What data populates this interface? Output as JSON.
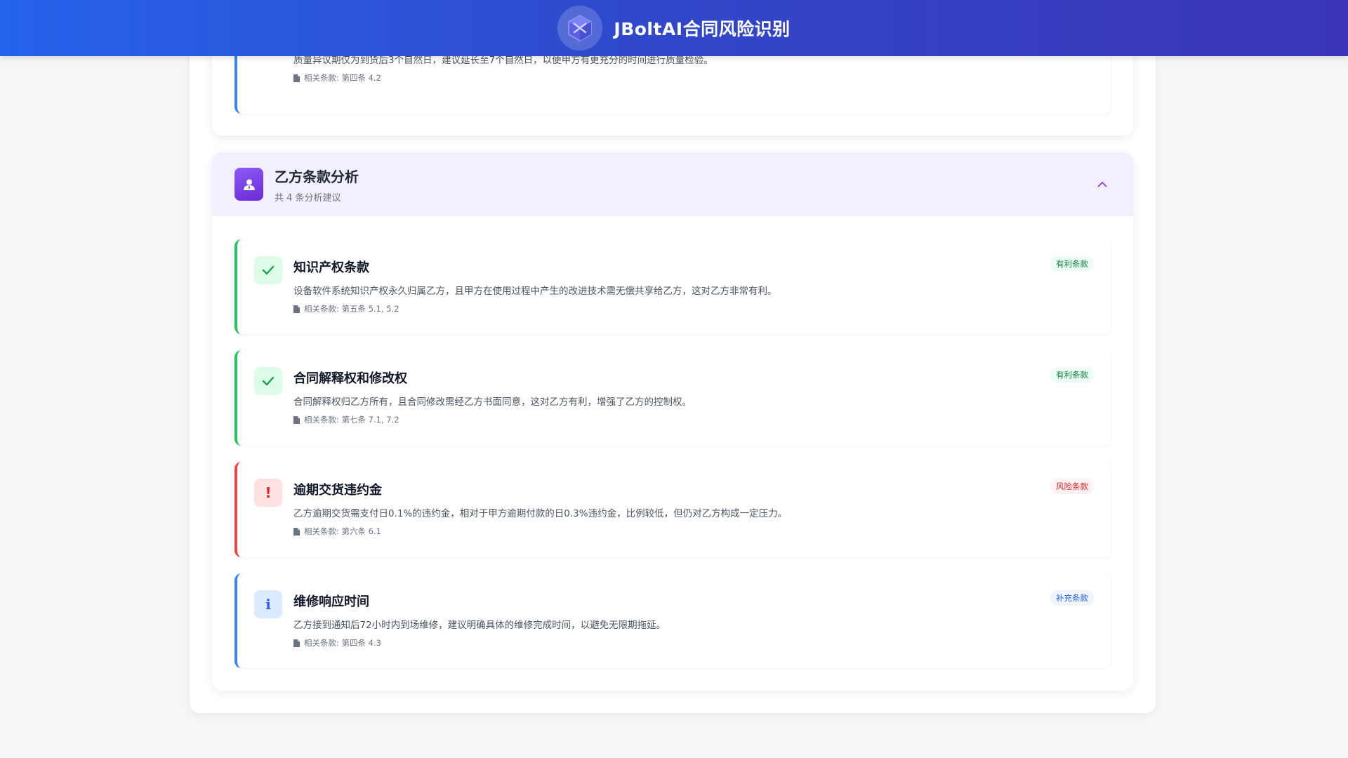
{
  "header": {
    "title": "JBoltAI合同风险识别"
  },
  "top_item": {
    "description": "质量异议期仅为到货后3个自然日，建议延长至7个自然日，以便甲方有更充分的时间进行质量检验。",
    "reference": "相关条款: 第四条 4.2",
    "color": "#3b82f6"
  },
  "party_b": {
    "title": "乙方条款分析",
    "subtitle": "共 4 条分析建议",
    "items": [
      {
        "title": "知识产权条款",
        "description": "设备软件系统知识产权永久归属乙方，且甲方在使用过程中产生的改进技术需无偿共享给乙方，这对乙方非常有利。",
        "reference": "相关条款: 第五条 5.1, 5.2",
        "badge": "有利条款",
        "icon": "check-icon",
        "color": "#22c55e"
      },
      {
        "title": "合同解释权和修改权",
        "description": "合同解释权归乙方所有，且合同修改需经乙方书面同意，这对乙方有利，增强了乙方的控制权。",
        "reference": "相关条款: 第七条 7.1, 7.2",
        "badge": "有利条款",
        "icon": "check-icon",
        "color": "#22c55e"
      },
      {
        "title": "逾期交货违约金",
        "description": "乙方逾期交货需支付日0.1%的违约金，相对于甲方逾期付款的日0.3%违约金，比例较低，但仍对乙方构成一定压力。",
        "reference": "相关条款: 第六条 6.1",
        "badge": "风险条款",
        "icon": "exclamation-icon",
        "color": "#ef4444"
      },
      {
        "title": "维修响应时间",
        "description": "乙方接到通知后72小时内到场维修，建议明确具体的维修完成时间，以避免无限期拖延。",
        "reference": "相关条款: 第四条 4.3",
        "badge": "补充条款",
        "icon": "info-icon",
        "color": "#3b82f6"
      }
    ]
  },
  "icon_glyphs": {
    "exclamation": "!",
    "info": "i"
  }
}
